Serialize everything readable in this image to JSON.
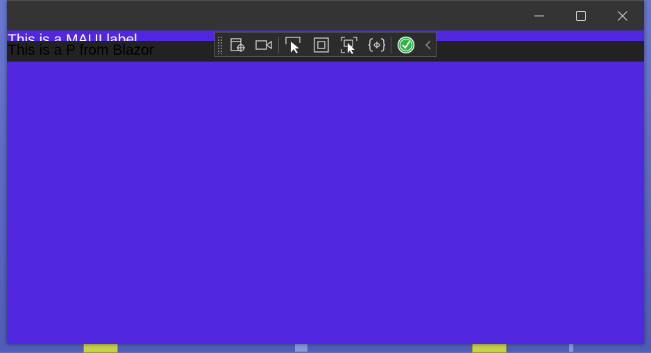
{
  "window": {
    "content_bg": "#5128e0",
    "titlebar_bg": "#343434"
  },
  "main": {
    "maui_label": "This is a MAUI label",
    "blazor_paragraph": "This is a P from Blazor"
  },
  "caption_buttons": [
    {
      "name": "minimize",
      "icon": "minimize-icon"
    },
    {
      "name": "maximize",
      "icon": "maximize-icon"
    },
    {
      "name": "close",
      "icon": "close-icon"
    }
  ],
  "dev_toolbar": {
    "buttons": [
      {
        "name": "go-to-live-visual-tree",
        "icon": "live-visual-tree-icon"
      },
      {
        "name": "show-in-app-toolbar-record",
        "icon": "video-camera-icon"
      },
      {
        "name": "select-element",
        "icon": "select-element-icon"
      },
      {
        "name": "display-layout-adorners",
        "icon": "layout-adorner-icon"
      },
      {
        "name": "track-focused-element",
        "icon": "track-focus-icon"
      },
      {
        "name": "binding-failures",
        "icon": "binding-icon"
      },
      {
        "name": "scan-for-accessibility-issues",
        "icon": "check-circle-icon"
      },
      {
        "name": "collapse-toolbar",
        "icon": "chevron-left-icon"
      }
    ],
    "status_color": "#2fb344"
  }
}
